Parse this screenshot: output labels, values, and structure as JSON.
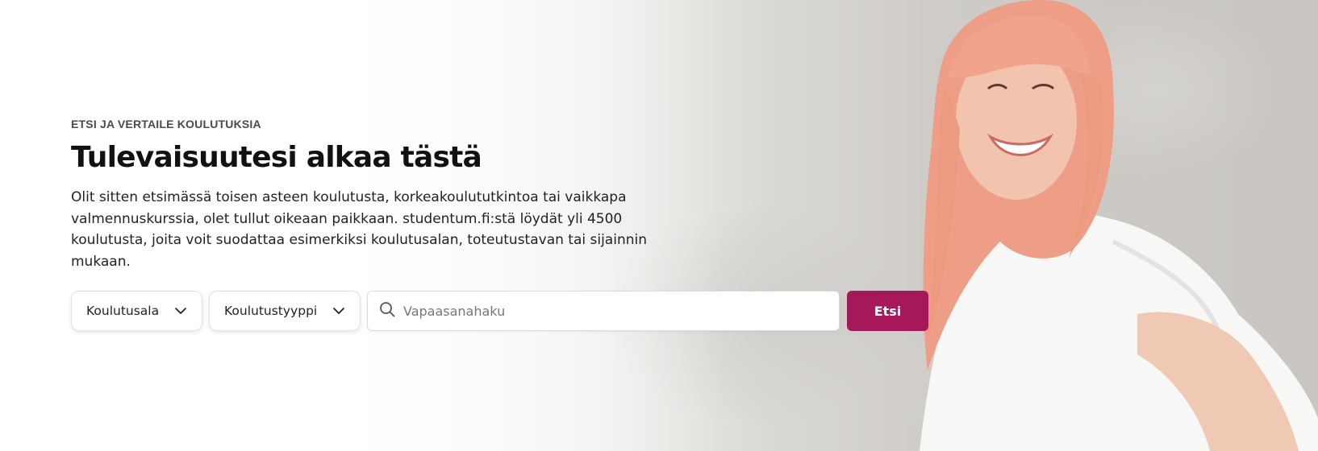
{
  "hero": {
    "eyebrow": "ETSI JA VERTAILE KOULUTUKSIA",
    "title": "Tulevaisuutesi alkaa tästä",
    "lead": "Olit sitten etsimässä toisen asteen koulutusta, korkeakoulututkintoa tai vaikkapa valmennuskurssia, olet tullut oikeaan paikkaan. studentum.fi:stä löydät yli 4500 koulutusta, joita voit suodattaa esimerkiksi koulutusalan, toteutustavan tai sijainnin mukaan."
  },
  "search": {
    "field_select_label": "Koulutusala",
    "type_select_label": "Koulutustyyppi",
    "placeholder": "Vapaasanahaku",
    "value": "",
    "button_label": "Etsi",
    "icons": {
      "dropdown": "chevron-down-icon",
      "search": "search-icon"
    }
  },
  "colors": {
    "accent": "#a5185a",
    "title": "#111111",
    "text": "#222222"
  }
}
